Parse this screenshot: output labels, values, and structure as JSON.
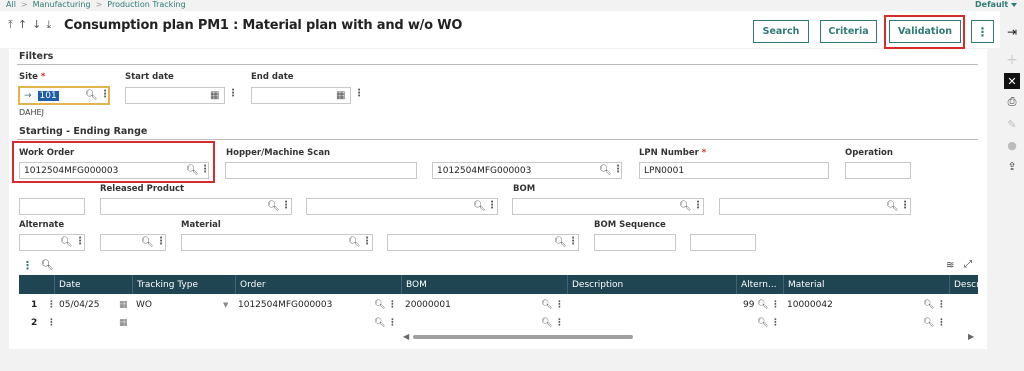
{
  "breadcrumb": {
    "items": [
      "All",
      "Manufacturing",
      "Production Tracking"
    ],
    "sep": ">"
  },
  "default_label": "Default",
  "title": "Consumption plan PM1 : Material plan with and w/o WO",
  "nav_arrows": [
    "⤒",
    "↑",
    "↓",
    "⤓"
  ],
  "buttons": {
    "search": "Search",
    "criteria": "Criteria",
    "validation": "Validation",
    "more": "⋮"
  },
  "filters": {
    "section": "Filters",
    "site_label": "Site",
    "site_value": "101",
    "site_desc": "DAHEJ",
    "start_date_label": "Start date",
    "end_date_label": "End date"
  },
  "range": {
    "section": "Starting - Ending Range",
    "work_order_label": "Work Order",
    "work_order_from": "1012504MFG000003",
    "hopper_label": "Hopper/Machine Scan",
    "work_order_to": "1012504MFG000003",
    "lpn_label": "LPN Number",
    "lpn_value": "LPN0001",
    "operation_label": "Operation",
    "released_product_label": "Released Product",
    "bom_label": "BOM",
    "alternate_label": "Alternate",
    "material_label": "Material",
    "bom_sequence_label": "BOM Sequence"
  },
  "grid": {
    "columns_left": [
      "Date",
      "Tracking Type",
      "Order"
    ],
    "columns_right": [
      "BOM",
      "Description",
      "Altern...",
      "Material",
      "Descr"
    ],
    "rows": [
      {
        "num": "1",
        "date": "05/04/25",
        "tracking": "WO",
        "order": "1012504MFG000003",
        "bom": "20000001",
        "description": "",
        "alternate": "99",
        "material": "10000042"
      },
      {
        "num": "2",
        "date": "",
        "tracking": "",
        "order": "",
        "bom": "",
        "description": "",
        "alternate": "",
        "material": ""
      }
    ]
  },
  "colors": {
    "accent": "#2f7a75",
    "grid_header": "#1f4553",
    "highlight": "#d62c2c",
    "required": "#d62c2c"
  }
}
